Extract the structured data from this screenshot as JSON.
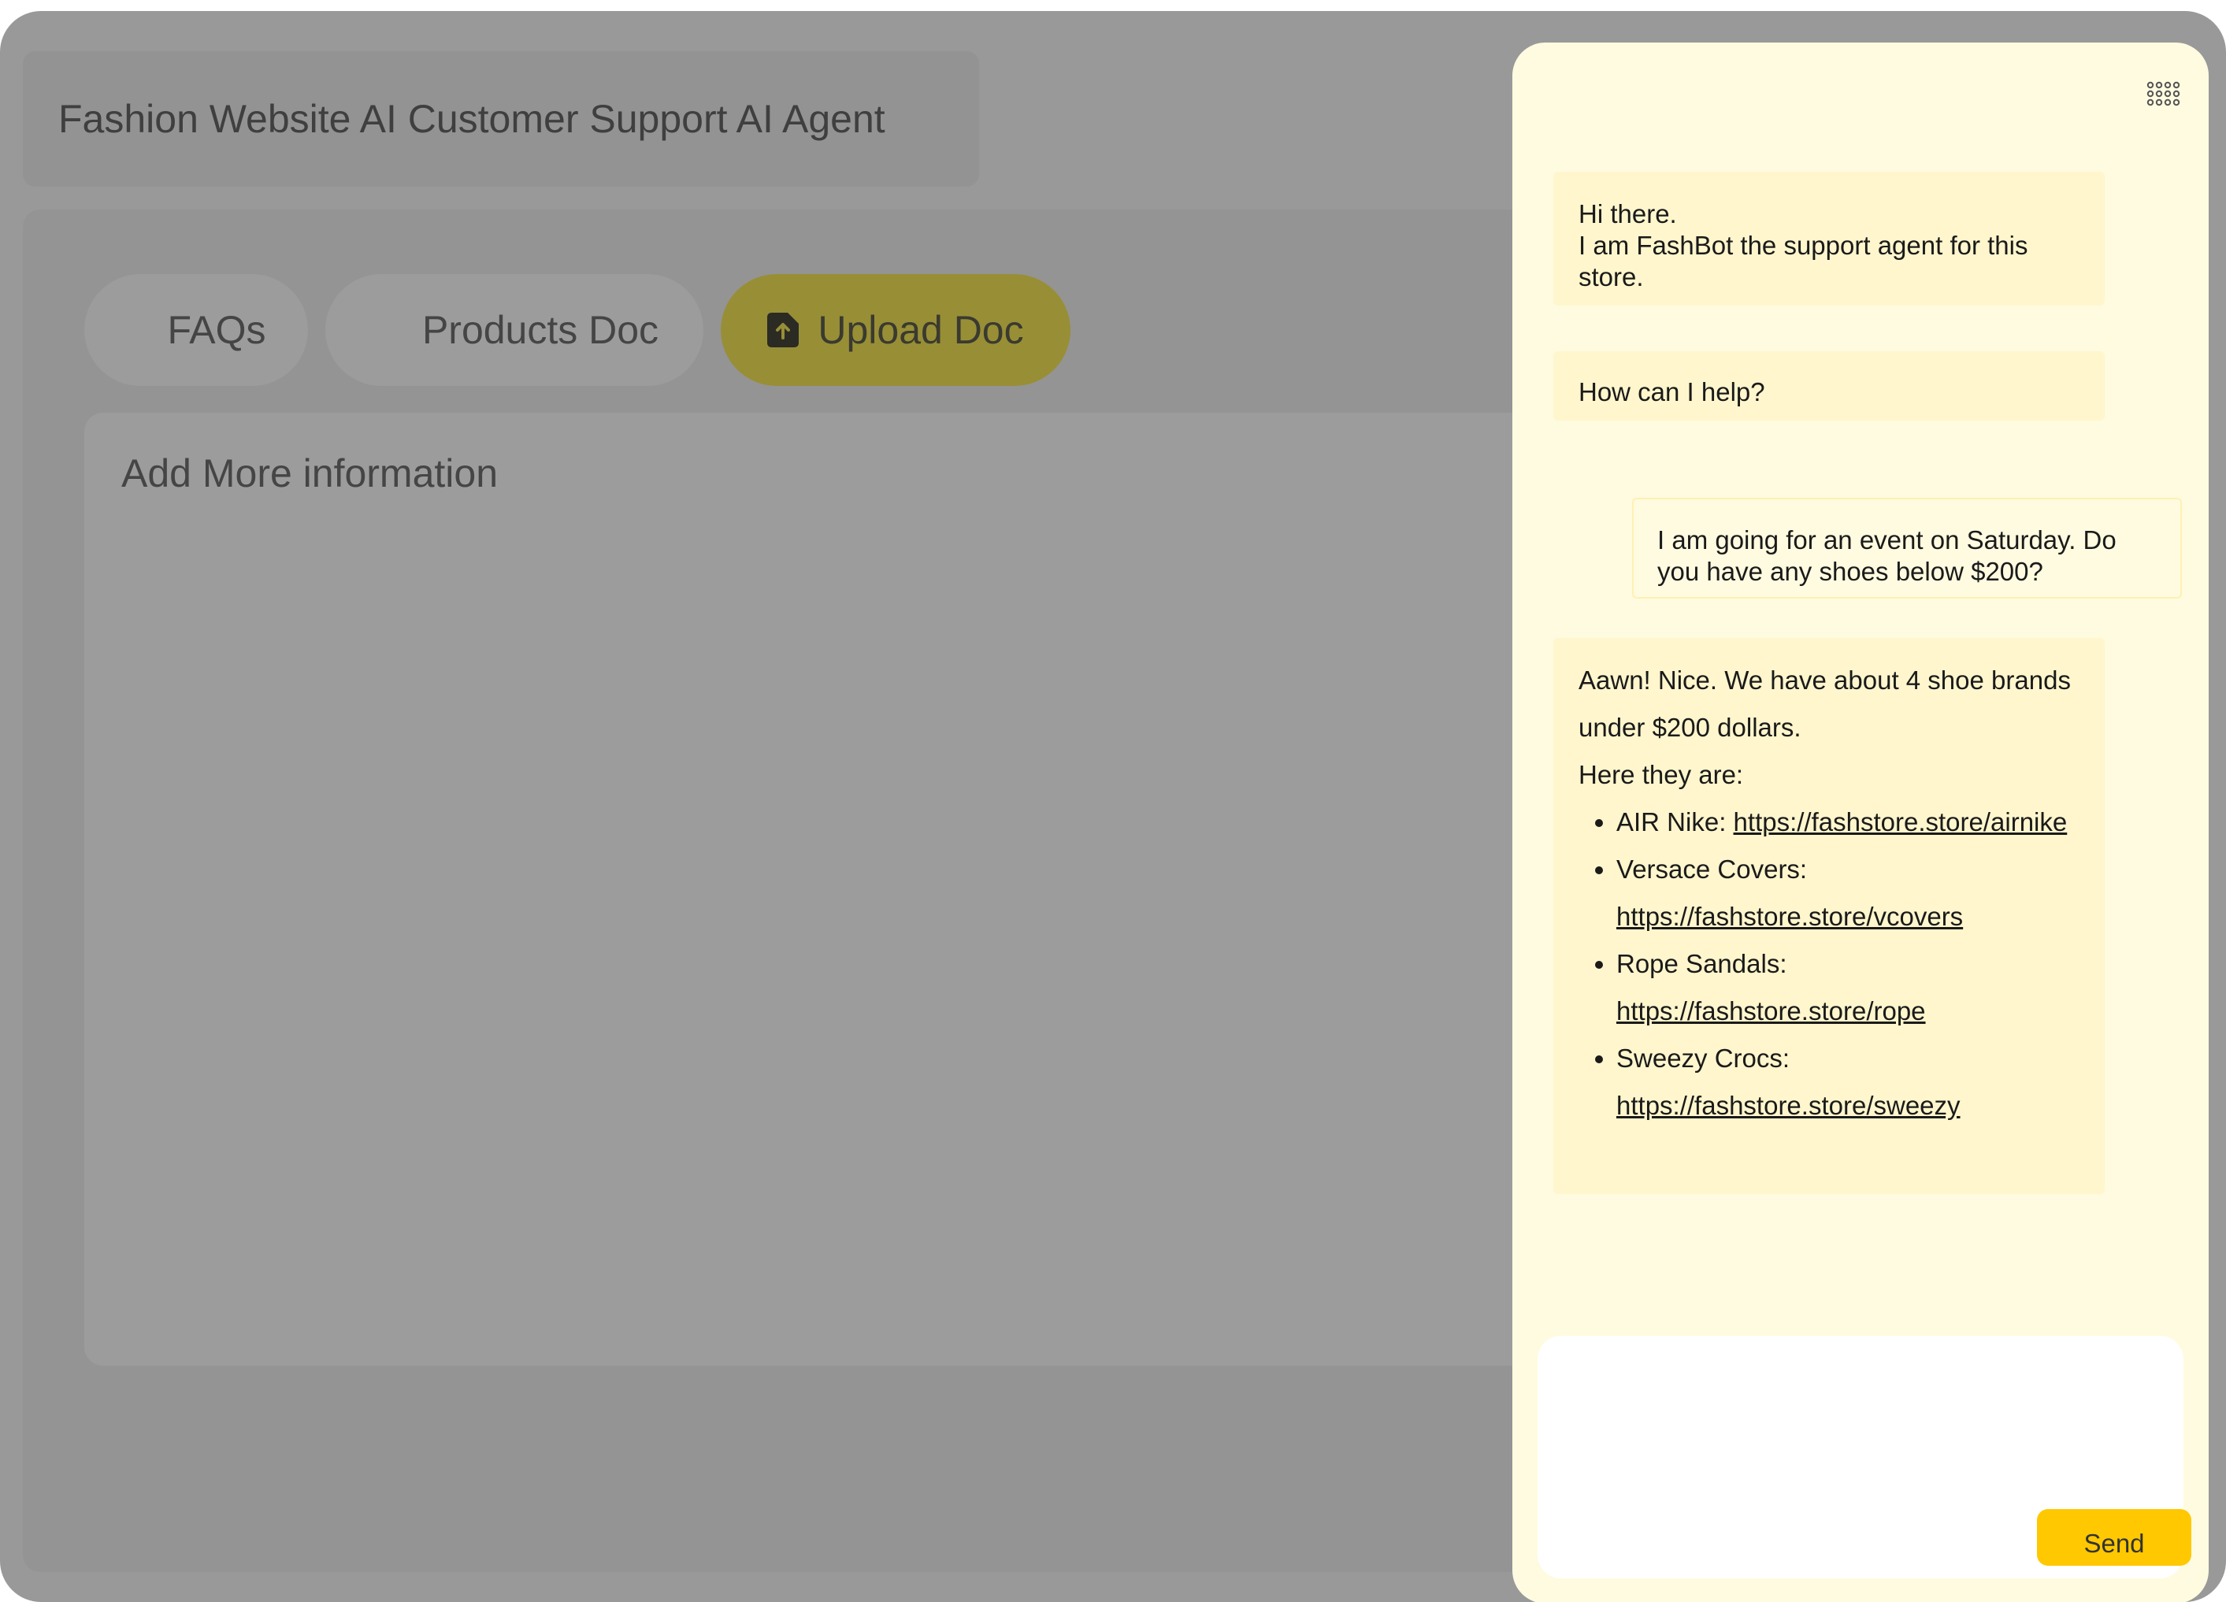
{
  "header": {
    "title": "Fashion Website AI Customer Support AI Agent"
  },
  "tabs": [
    {
      "label": "FAQs"
    },
    {
      "label": "Products Doc"
    },
    {
      "label": "Upload Doc",
      "icon": "upload-file-icon",
      "active": true
    }
  ],
  "info_box": {
    "title": "Add More information"
  },
  "colors": {
    "backdrop": "#999999",
    "active_tab": "#988e36",
    "chat_background": "#fffbe0",
    "bot_bubble": "#fff6cd",
    "send_button": "#ffc800"
  },
  "chat": {
    "menu_icon": "grid-dots-icon",
    "messages": [
      {
        "sender": "bot",
        "lines": [
          "Hi there.",
          "I am FashBot the support agent for this store."
        ]
      },
      {
        "sender": "bot",
        "lines": [
          "How can I help?"
        ]
      },
      {
        "sender": "user",
        "lines": [
          "I am going for an event on Saturday. Do you have any shoes below $200?"
        ]
      },
      {
        "sender": "bot",
        "intro": "Aawn! Nice. We have about 4 shoe brands under $200 dollars.",
        "lead": "Here they are:",
        "items": [
          {
            "name": "AIR Nike: ",
            "link": "https://fashstore.store/airnike"
          },
          {
            "name": "Versace Covers: ",
            "link": "https://fashstore.store/vcovers"
          },
          {
            "name": "Rope Sandals: ",
            "link": "https://fashstore.store/rope"
          },
          {
            "name": "Sweezy Crocs: ",
            "link": "https://fashstore.store/sweezy"
          }
        ]
      }
    ],
    "input": {
      "value": "",
      "placeholder": ""
    },
    "send_label": "Send"
  }
}
